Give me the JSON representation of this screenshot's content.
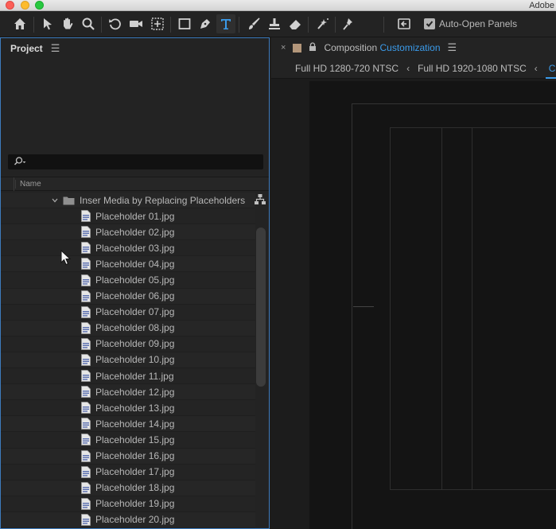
{
  "window": {
    "app_title": "Adobe"
  },
  "toolbar": {
    "tools": [
      "home-icon",
      "selection-icon",
      "hand-icon",
      "zoom-icon",
      "rotate-icon",
      "camera-icon",
      "pan-behind-icon",
      "rectangle-icon",
      "pen-icon",
      "type-icon",
      "brush-icon",
      "clone-stamp-icon",
      "eraser-icon",
      "roto-brush-icon",
      "puppet-pin-icon"
    ],
    "active_tool": "type-icon",
    "auto_open_label": "Auto-Open Panels",
    "auto_open_checked": true
  },
  "project": {
    "title": "Project",
    "search_placeholder": "",
    "column_name": "Name",
    "folder": "Inser Media by Replacing Placeholders",
    "files": [
      "Placeholder 01.jpg",
      "Placeholder 02.jpg",
      "Placeholder 03.jpg",
      "Placeholder 04.jpg",
      "Placeholder 05.jpg",
      "Placeholder 06.jpg",
      "Placeholder 07.jpg",
      "Placeholder 08.jpg",
      "Placeholder 09.jpg",
      "Placeholder 10.jpg",
      "Placeholder 11.jpg",
      "Placeholder 12.jpg",
      "Placeholder 13.jpg",
      "Placeholder 14.jpg",
      "Placeholder 15.jpg",
      "Placeholder 16.jpg",
      "Placeholder 17.jpg",
      "Placeholder 18.jpg",
      "Placeholder 19.jpg",
      "Placeholder 20.jpg"
    ]
  },
  "composition": {
    "label": "Composition",
    "name": "Customization",
    "tabs": [
      "Full HD 1280-720 NTSC",
      "Full HD 1920-1080 NTSC"
    ],
    "current_tab": "Cu"
  },
  "colors": {
    "accent": "#3b9bea",
    "label_swatch": "#b3967a",
    "panel_border": "#3d7bbd"
  }
}
